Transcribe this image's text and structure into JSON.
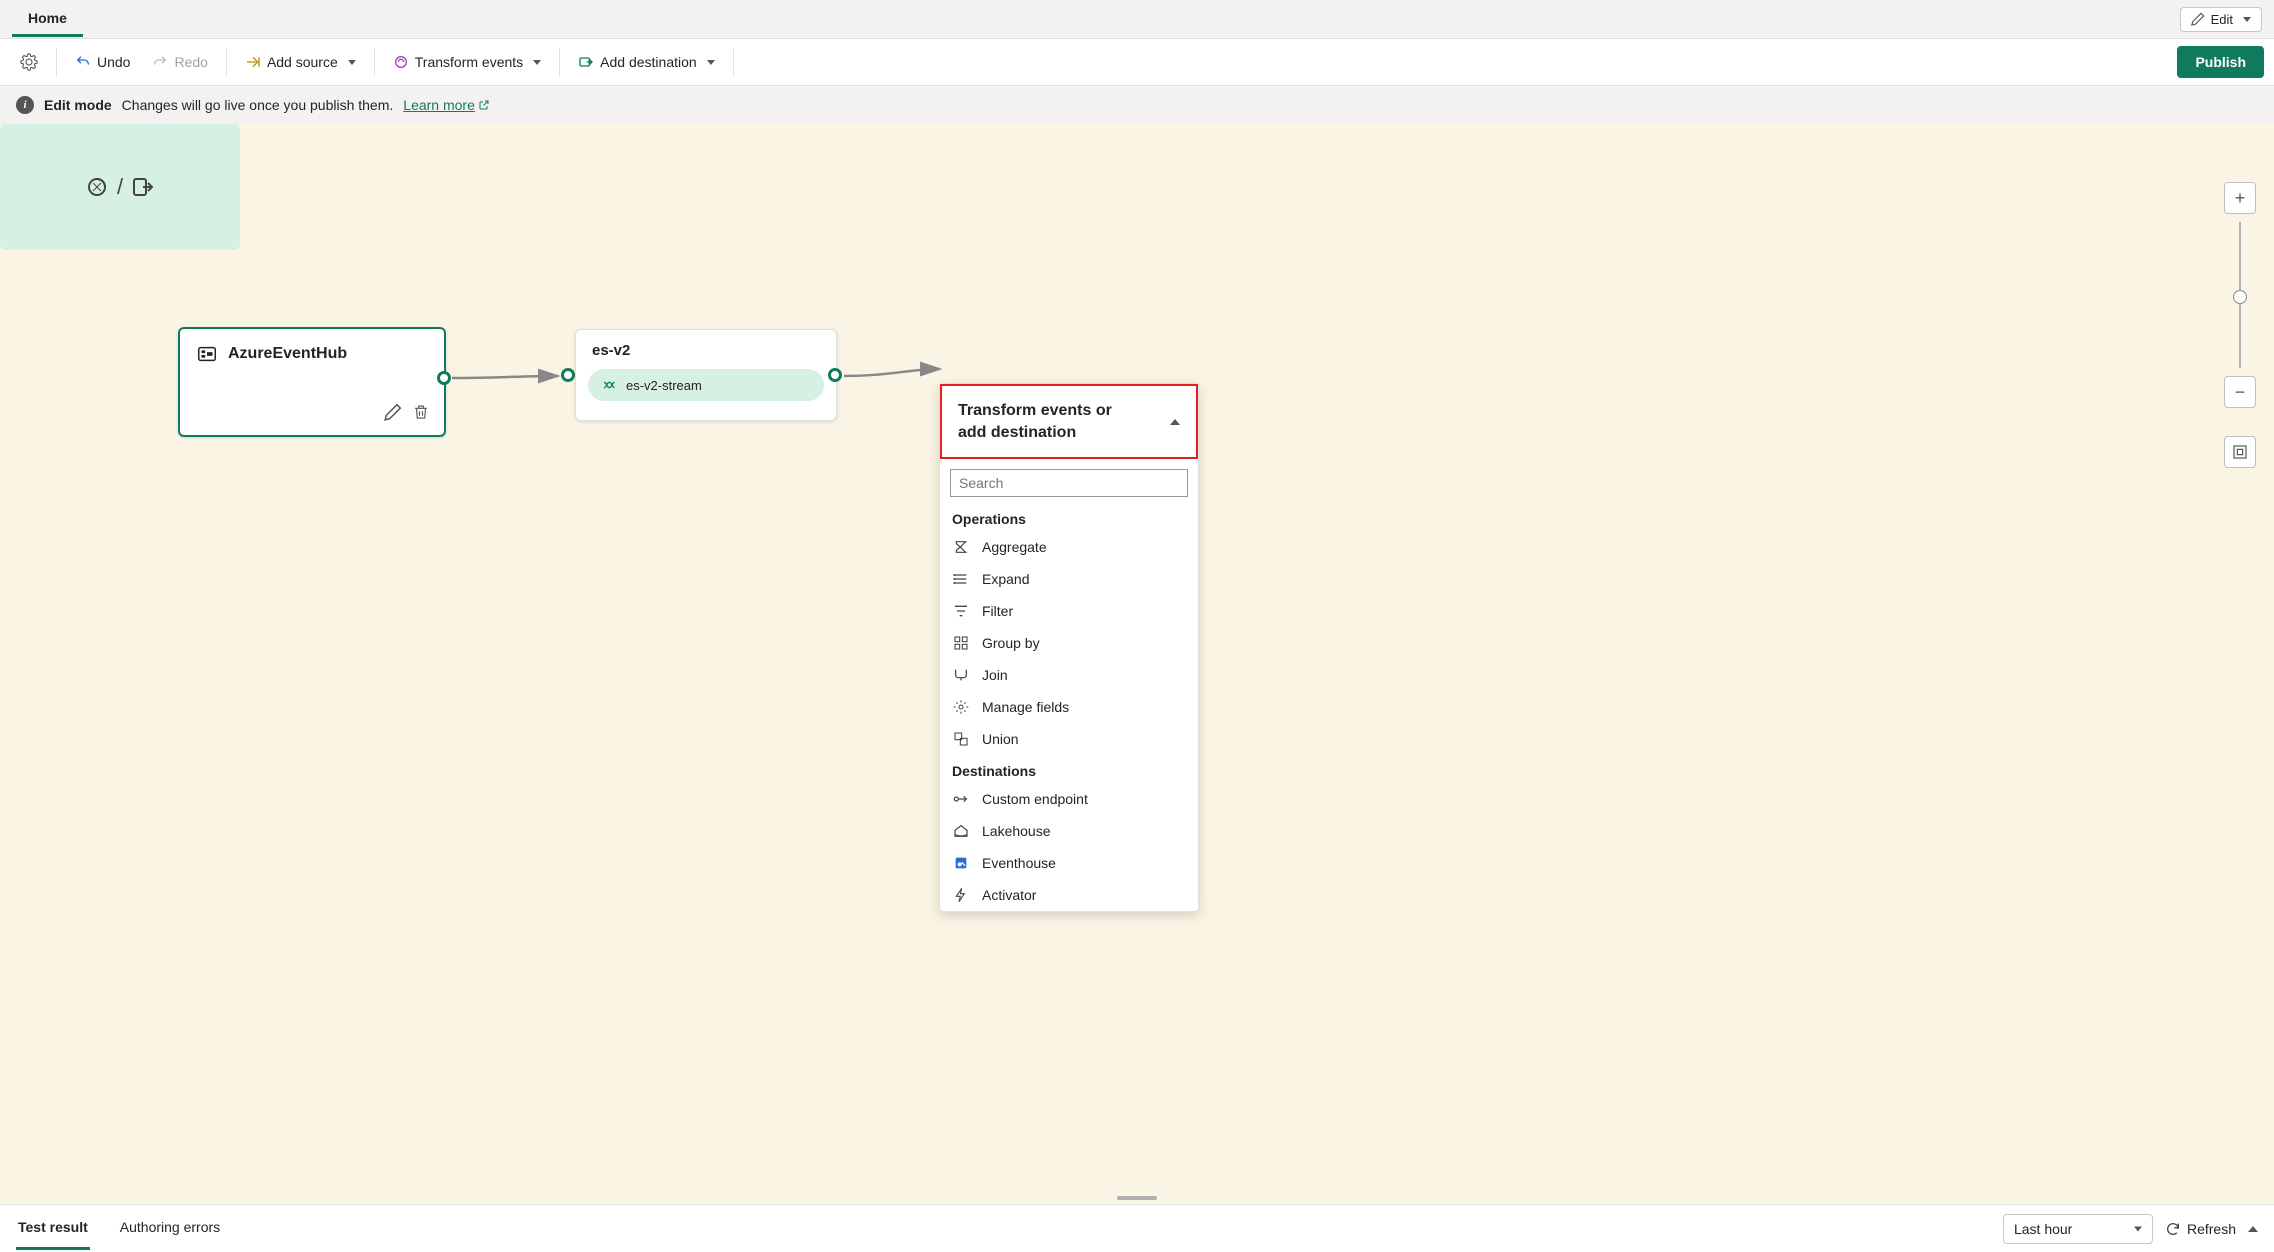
{
  "tabs": {
    "home": "Home"
  },
  "editBtn": "Edit",
  "toolbar": {
    "undo": "Undo",
    "redo": "Redo",
    "addSource": "Add source",
    "transform": "Transform events",
    "addDest": "Add destination",
    "publish": "Publish"
  },
  "editMode": {
    "title": "Edit mode",
    "msg": "Changes will go live once you publish them.",
    "learn": "Learn more"
  },
  "nodes": {
    "source": "AzureEventHub",
    "stream": "es-v2",
    "streamPill": "es-v2-stream"
  },
  "dropdown": {
    "title": "Transform events or add destination",
    "searchPlaceholder": "Search",
    "opTitle": "Operations",
    "ops": {
      "aggregate": "Aggregate",
      "expand": "Expand",
      "filter": "Filter",
      "groupBy": "Group by",
      "join": "Join",
      "manageFields": "Manage fields",
      "union": "Union"
    },
    "destTitle": "Destinations",
    "dests": {
      "custom": "Custom endpoint",
      "lakehouse": "Lakehouse",
      "eventhouse": "Eventhouse",
      "activator": "Activator"
    }
  },
  "bottom": {
    "testResult": "Test result",
    "authErrors": "Authoring errors",
    "timeRange": "Last hour",
    "refresh": "Refresh"
  }
}
